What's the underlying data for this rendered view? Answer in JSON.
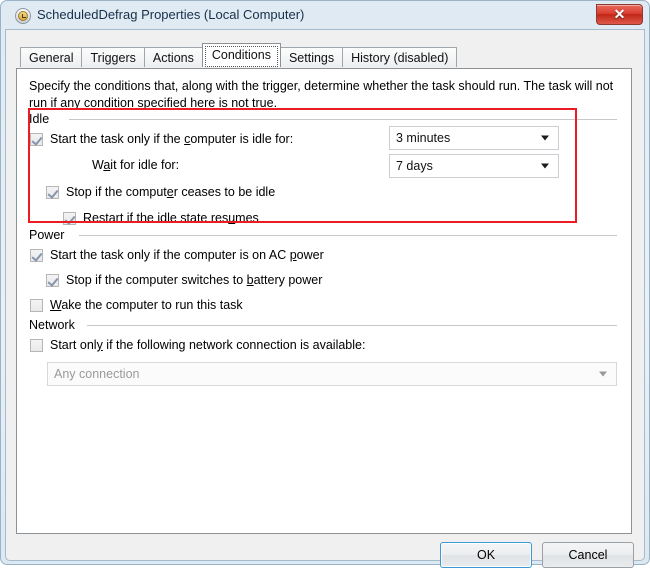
{
  "window": {
    "title": "ScheduledDefrag Properties (Local Computer)",
    "icon": "clock-icon",
    "close_label": "✕",
    "accent_red": "#ec1c24",
    "titlebar_color": "#dfeaf3"
  },
  "tabs": [
    {
      "label": "General",
      "active": false
    },
    {
      "label": "Triggers",
      "active": false
    },
    {
      "label": "Actions",
      "active": false
    },
    {
      "label": "Conditions",
      "active": true
    },
    {
      "label": "Settings",
      "active": false
    },
    {
      "label": "History (disabled)",
      "active": false
    }
  ],
  "description": "Specify the conditions that, along with the trigger, determine whether the task should run.  The task will not run  if any condition specified here is not true.",
  "groups": {
    "idle": {
      "label": "Idle",
      "rows": {
        "start_idle": {
          "pre": "Start the task only if the ",
          "accel": "c",
          "post": "omputer is idle for:",
          "checked": true
        },
        "wait_idle": {
          "pre": "W",
          "accel": "a",
          "post": "it for idle for:"
        },
        "stop_ceases": {
          "pre": "Stop if the comput",
          "accel": "e",
          "post": "r ceases to be idle",
          "checked": true
        },
        "restart_resumes": {
          "pre": "Restart if the idle state res",
          "accel": "u",
          "post": "mes",
          "checked": true
        }
      },
      "combos": {
        "idle_duration": "3 minutes",
        "wait_duration": "7 days"
      }
    },
    "power": {
      "label": "Power",
      "rows": {
        "ac_power": {
          "pre": "Start the task only if the computer is on AC ",
          "accel": "p",
          "post": "ower",
          "checked": true
        },
        "battery_stop": {
          "pre": "Stop if the computer switches to ",
          "accel": "b",
          "post": "attery power",
          "checked": true
        },
        "wake_computer": {
          "pre": "",
          "accel": "W",
          "post": "ake the computer to run this task",
          "checked": false
        }
      }
    },
    "network": {
      "label": "Network",
      "rows": {
        "network_required": {
          "pre": "Start onl",
          "accel": "y",
          "post": " if the following network connection is available:",
          "checked": false
        }
      },
      "combos": {
        "connection": "Any connection"
      }
    }
  },
  "footer": {
    "ok_label": "OK",
    "cancel_label": "Cancel"
  }
}
